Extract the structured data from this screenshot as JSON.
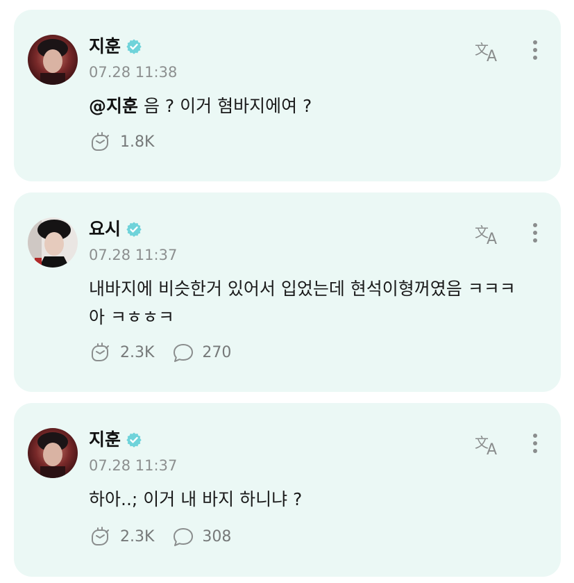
{
  "colors": {
    "card_background": "#ebf8f5",
    "verified_badge": "#6fd3da",
    "icon_gray": "#8a8d8d",
    "timestamp_gray": "#8c8f8f"
  },
  "posts": [
    {
      "author": "지훈",
      "verified": true,
      "timestamp": "07.28 11:38",
      "mention": "@지훈",
      "text": " 음 ? 이거 혐바지에여 ?",
      "likes": "1.8K",
      "comments": null,
      "icons": [
        "avatar",
        "verified-badge-icon",
        "translate-icon",
        "more-options-icon",
        "like-hands-icon"
      ]
    },
    {
      "author": "요시",
      "verified": true,
      "timestamp": "07.28 11:37",
      "text": "내바지에 비슷한거 있어서 입었는데 현석이형꺼였음 ㅋㅋㅋ 아 ㅋㅎㅎㅋ",
      "likes": "2.3K",
      "comments": "270",
      "icons": [
        "avatar",
        "verified-badge-icon",
        "translate-icon",
        "more-options-icon",
        "like-hands-icon",
        "comment-bubble-icon"
      ]
    },
    {
      "author": "지훈",
      "verified": true,
      "timestamp": "07.28 11:37",
      "text": "하아..; 이거 내 바지 하니냐 ?",
      "likes": "2.3K",
      "comments": "308",
      "icons": [
        "avatar",
        "verified-badge-icon",
        "translate-icon",
        "more-options-icon",
        "like-hands-icon",
        "comment-bubble-icon"
      ]
    }
  ]
}
